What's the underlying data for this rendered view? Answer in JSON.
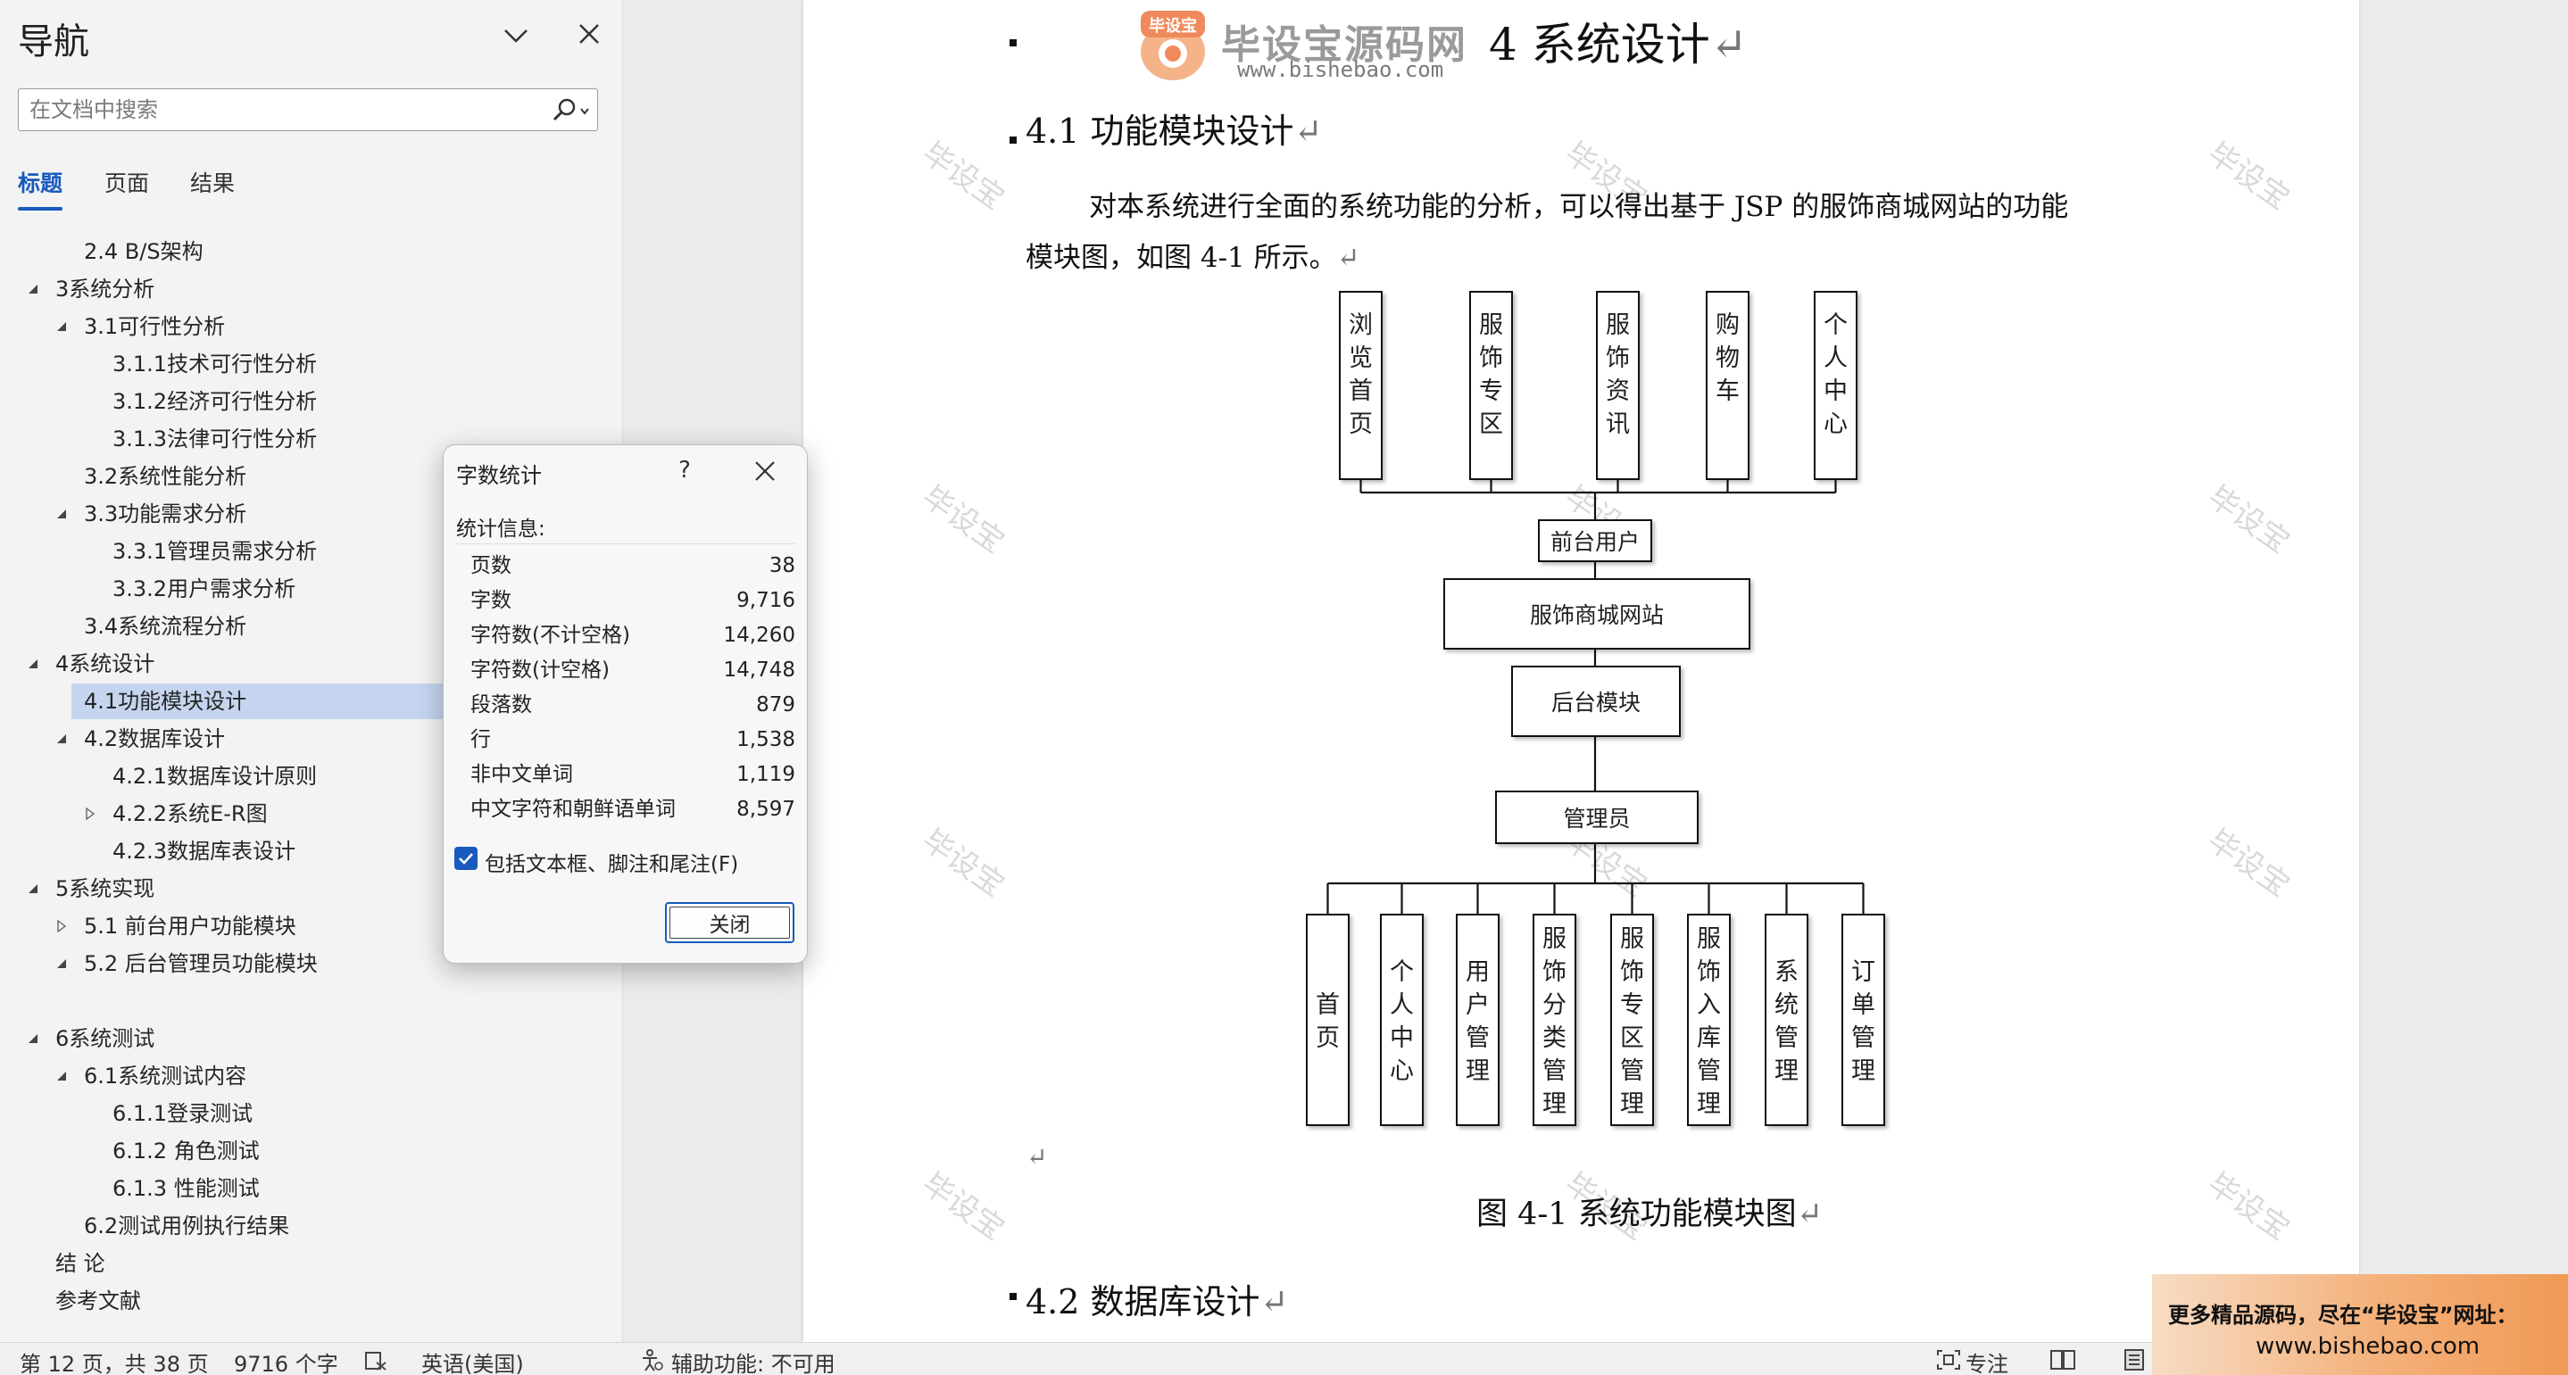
{
  "nav": {
    "title": "导航",
    "search_placeholder": "在文档中搜索",
    "tabs": [
      "标题",
      "页面",
      "结果"
    ],
    "tree": [
      {
        "label": "2.4 B/S架构",
        "level": 2,
        "arrow": "none"
      },
      {
        "label": "3系统分析",
        "level": 1,
        "arrow": "expanded"
      },
      {
        "label": "3.1可行性分析",
        "level": 2,
        "arrow": "expanded"
      },
      {
        "label": "3.1.1技术可行性分析",
        "level": 3,
        "arrow": "none"
      },
      {
        "label": "3.1.2经济可行性分析",
        "level": 3,
        "arrow": "none"
      },
      {
        "label": "3.1.3法律可行性分析",
        "level": 3,
        "arrow": "none"
      },
      {
        "label": "3.2系统性能分析",
        "level": 2,
        "arrow": "none"
      },
      {
        "label": "3.3功能需求分析",
        "level": 2,
        "arrow": "expanded"
      },
      {
        "label": "3.3.1管理员需求分析",
        "level": 3,
        "arrow": "none"
      },
      {
        "label": "3.3.2用户需求分析",
        "level": 3,
        "arrow": "none"
      },
      {
        "label": "3.4系统流程分析",
        "level": 2,
        "arrow": "none"
      },
      {
        "label": "4系统设计",
        "level": 1,
        "arrow": "expanded"
      },
      {
        "label": "4.1功能模块设计",
        "level": 2,
        "arrow": "none",
        "selected": true
      },
      {
        "label": "4.2数据库设计",
        "level": 2,
        "arrow": "expanded"
      },
      {
        "label": "4.2.1数据库设计原则",
        "level": 3,
        "arrow": "none"
      },
      {
        "label": "4.2.2系统E-R图",
        "level": 3,
        "arrow": "collapsed"
      },
      {
        "label": "4.2.3数据库表设计",
        "level": 3,
        "arrow": "none"
      },
      {
        "label": "5系统实现",
        "level": 1,
        "arrow": "expanded"
      },
      {
        "label": "5.1 前台用户功能模块",
        "level": 2,
        "arrow": "collapsed"
      },
      {
        "label": "5.2 后台管理员功能模块",
        "level": 2,
        "arrow": "expanded"
      },
      {
        "label": "",
        "level": 2,
        "arrow": "none"
      },
      {
        "label": "6系统测试",
        "level": 1,
        "arrow": "expanded"
      },
      {
        "label": "6.1系统测试内容",
        "level": 2,
        "arrow": "expanded"
      },
      {
        "label": "6.1.1登录测试",
        "level": 3,
        "arrow": "none"
      },
      {
        "label": "6.1.2 角色测试",
        "level": 3,
        "arrow": "none"
      },
      {
        "label": "6.1.3 性能测试",
        "level": 3,
        "arrow": "none"
      },
      {
        "label": "6.2测试用例执行结果",
        "level": 2,
        "arrow": "none"
      },
      {
        "label": "结  论",
        "level": 1,
        "arrow": "none"
      },
      {
        "label": "参考文献",
        "level": 1,
        "arrow": "none"
      }
    ]
  },
  "status": {
    "page": "第 12 页，共 38 页",
    "words": "9716 个字",
    "language": "英语(美国)",
    "accessibility": "辅助功能: 不可用",
    "focus": "专注"
  },
  "document": {
    "logo_text": "毕设宝源码网",
    "logo_badge": "毕设宝",
    "logo_url": "www.bishebao.com",
    "heading_chapter": "4 系统设计",
    "heading_41": "4.1 功能模块设计",
    "para_line1": "对本系统进行全面的系统功能的分析，可以得出基于 JSP 的服饰商城网站的功能",
    "para_line2": "模块图，如图 4-1 所示。",
    "caption": "图 4-1  系统功能模块图",
    "heading_42": "4.2 数据库设计",
    "return_mark": "↵",
    "watermark": "毕设宝"
  },
  "diagram": {
    "top_modules": [
      "浏览首页",
      "服饰专区",
      "服饰资讯",
      "购物车",
      "个人中心"
    ],
    "front_user": "前台用户",
    "site": "服饰商城网站",
    "backend": "后台模块",
    "admin": "管理员",
    "bottom_modules": [
      "首页",
      "个人中心",
      "用户管理",
      "服饰分类管理",
      "服饰专区管理",
      "服饰入库管理",
      "系统管理",
      "订单管理"
    ]
  },
  "dialog": {
    "title": "字数统计",
    "help": "?",
    "section": "统计信息:",
    "stats": [
      {
        "name": "页数",
        "value": "38"
      },
      {
        "name": "字数",
        "value": "9,716"
      },
      {
        "name": "字符数(不计空格)",
        "value": "14,260"
      },
      {
        "name": "字符数(计空格)",
        "value": "14,748"
      },
      {
        "name": "段落数",
        "value": "879"
      },
      {
        "name": "行",
        "value": "1,538"
      },
      {
        "name": "非中文单词",
        "value": "1,119"
      },
      {
        "name": "中文字符和朝鲜语单词",
        "value": "8,597"
      }
    ],
    "checkbox_label": "包括文本框、脚注和尾注(F)",
    "checkbox_checked": true,
    "close_label": "关闭"
  },
  "ad": {
    "line1": "更多精品源码，尽在“毕设宝”网址：",
    "line2": "www.bishebao.com"
  },
  "colors": {
    "accent": "#185abd",
    "selection": "#c5d5ef"
  }
}
